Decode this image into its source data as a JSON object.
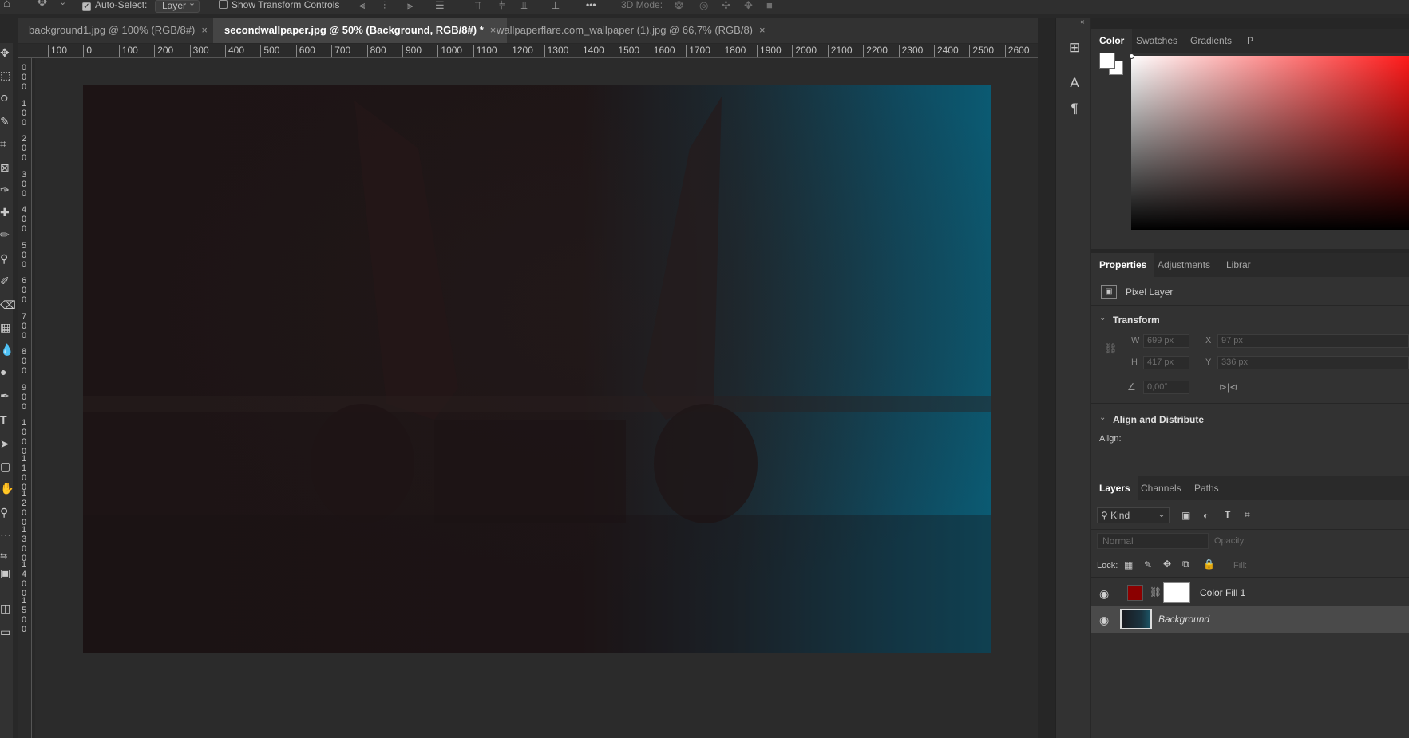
{
  "options_bar": {
    "home_icon": "home-icon",
    "move_icon": "move-tool-icon",
    "auto_select_label": "Auto-Select:",
    "auto_select_value": "Layer",
    "show_transform_label": "Show Transform Controls",
    "more_label": "•••",
    "mode_3d_label": "3D Mode:"
  },
  "tabs": [
    {
      "label": "background1.jpg @ 100% (RGB/8#)",
      "close": "×"
    },
    {
      "label": "secondwallpaper.jpg @ 50% (Background, RGB/8#) *",
      "close": "×"
    },
    {
      "label": "wallpaperflare.com_wallpaper (1).jpg @ 66,7% (RGB/8)",
      "close": "×"
    }
  ],
  "ruler_h": [
    "100",
    "0",
    "100",
    "200",
    "300",
    "400",
    "500",
    "600",
    "700",
    "800",
    "900",
    "1000",
    "1100",
    "1200",
    "1300",
    "1400",
    "1500",
    "1600",
    "1700",
    "1800",
    "1900",
    "2000",
    "2100",
    "2200",
    "2300",
    "2400",
    "2500",
    "2600"
  ],
  "ruler_v": [
    "0\n0\n0",
    "1\n0\n0",
    "2\n0\n0",
    "3\n0\n0",
    "4\n0\n0",
    "5\n0\n0",
    "6\n0\n0",
    "7\n0\n0",
    "8\n0\n0",
    "9\n0\n0",
    "1\n0\n0\n0",
    "1\n1\n0\n0",
    "1\n2\n0\n0",
    "1\n3\n0\n0",
    "1\n4\n0\n0",
    "1\n5\n0\n0"
  ],
  "color_panel": {
    "tabs": [
      "Color",
      "Swatches",
      "Gradients",
      "P"
    ],
    "foreground": "#ffffff",
    "background": "#ffffff",
    "hue": "#ff1a1a"
  },
  "properties_panel": {
    "tabs": [
      "Properties",
      "Adjustments",
      "Librar"
    ],
    "layer_type": "Pixel Layer",
    "transform_title": "Transform",
    "w_label": "W",
    "w_value": "699 px",
    "x_label": "X",
    "x_value": "97 px",
    "h_label": "H",
    "h_value": "417 px",
    "y_label": "Y",
    "y_value": "336 px",
    "angle_value": "0,00°",
    "align_title": "Align and Distribute",
    "align_label": "Align:"
  },
  "layers_panel": {
    "tabs": [
      "Layers",
      "Channels",
      "Paths"
    ],
    "kind_label": "Kind",
    "blend_mode": "Normal",
    "opacity_label": "Opacity:",
    "lock_label": "Lock:",
    "fill_label": "Fill:",
    "layers": [
      {
        "name": "Color Fill 1",
        "color": "#8b0000"
      },
      {
        "name": "Background"
      }
    ]
  }
}
